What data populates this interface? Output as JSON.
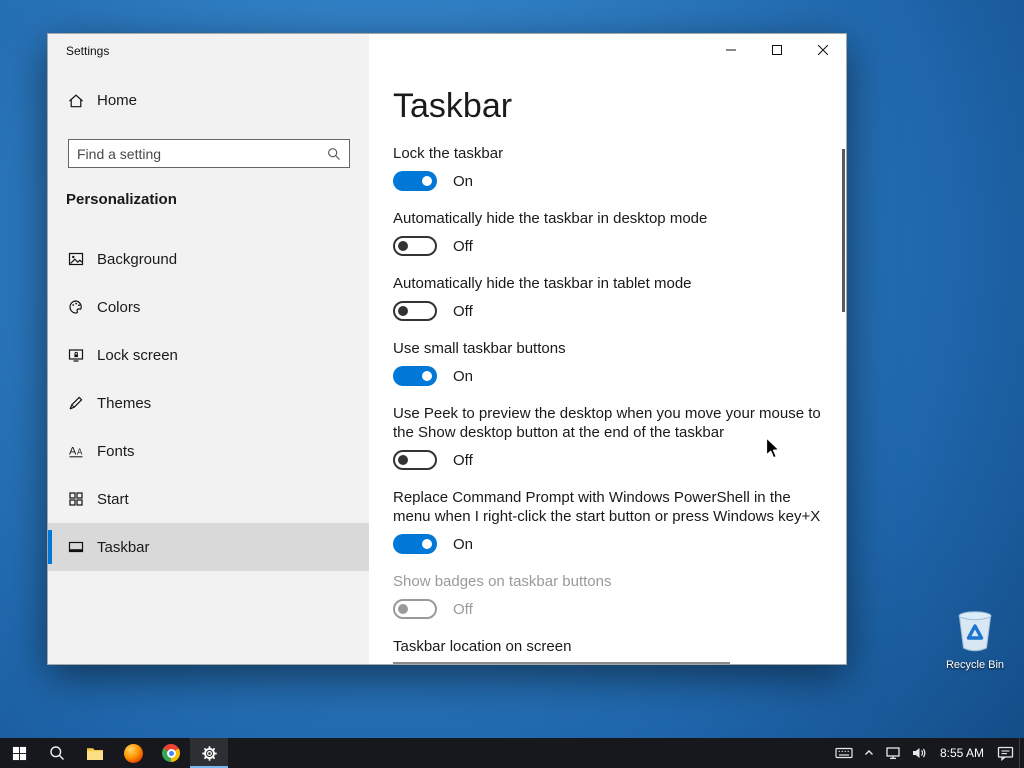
{
  "colors": {
    "accent": "#0078d7"
  },
  "desktop": {
    "recycle_bin_label": "Recycle Bin"
  },
  "window": {
    "title": "Settings",
    "sidebar": {
      "home_label": "Home",
      "search_placeholder": "Find a setting",
      "section_title": "Personalization",
      "items": [
        {
          "label": "Background",
          "icon": "background-icon",
          "selected": false
        },
        {
          "label": "Colors",
          "icon": "colors-icon",
          "selected": false
        },
        {
          "label": "Lock screen",
          "icon": "lock-screen-icon",
          "selected": false
        },
        {
          "label": "Themes",
          "icon": "themes-icon",
          "selected": false
        },
        {
          "label": "Fonts",
          "icon": "fonts-icon",
          "selected": false
        },
        {
          "label": "Start",
          "icon": "start-icon",
          "selected": false
        },
        {
          "label": "Taskbar",
          "icon": "taskbar-icon",
          "selected": true
        }
      ]
    },
    "main": {
      "title": "Taskbar",
      "settings": [
        {
          "label": "Lock the taskbar",
          "state": "On",
          "on": true,
          "disabled": false
        },
        {
          "label": "Automatically hide the taskbar in desktop mode",
          "state": "Off",
          "on": false,
          "disabled": false
        },
        {
          "label": "Automatically hide the taskbar in tablet mode",
          "state": "Off",
          "on": false,
          "disabled": false
        },
        {
          "label": "Use small taskbar buttons",
          "state": "On",
          "on": true,
          "disabled": false
        },
        {
          "label": "Use Peek to preview the desktop when you move your mouse to the Show desktop button at the end of the taskbar",
          "state": "Off",
          "on": false,
          "disabled": false
        },
        {
          "label": "Replace Command Prompt with Windows PowerShell in the menu when I right-click the start button or press Windows key+X",
          "state": "On",
          "on": true,
          "disabled": false
        },
        {
          "label": "Show badges on taskbar buttons",
          "state": "Off",
          "on": false,
          "disabled": true
        }
      ],
      "dropdown_label": "Taskbar location on screen"
    }
  },
  "taskbar": {
    "time": "8:55 AM"
  }
}
